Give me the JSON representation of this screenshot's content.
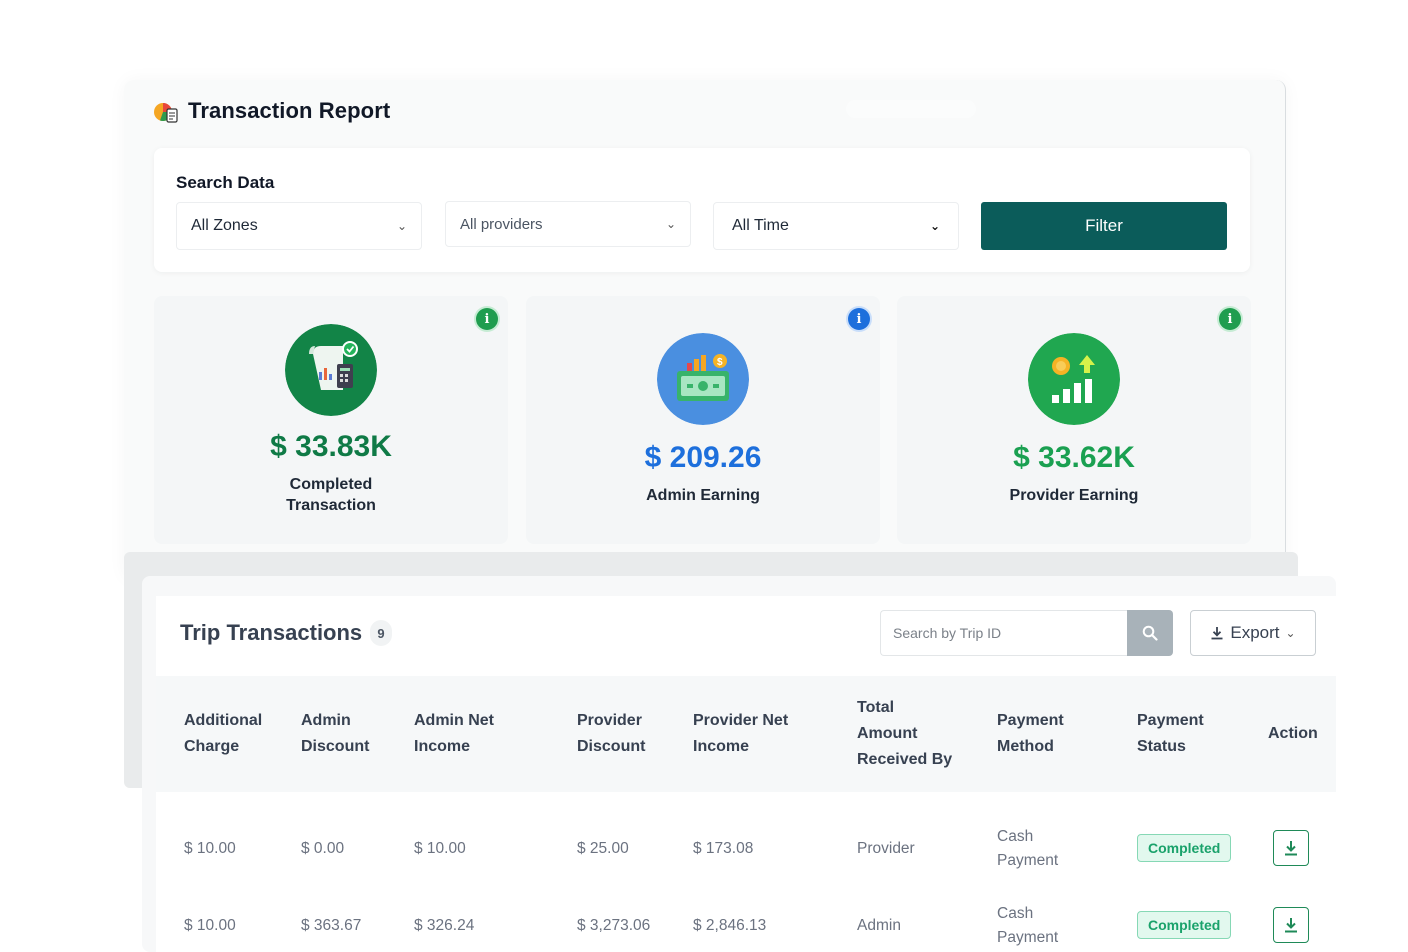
{
  "report": {
    "title": "Transaction Report",
    "search_label": "Search Data",
    "filters": [
      {
        "name": "zone",
        "value": "All Zones"
      },
      {
        "name": "provider",
        "value": "All providers"
      },
      {
        "name": "time",
        "value": "All Time"
      }
    ],
    "filter_button": "Filter"
  },
  "stats": [
    {
      "value": "$ 33.83K",
      "label_line1": "Completed",
      "label_line2": "Transaction",
      "color": "#0f7a46",
      "icon": "receipt-chart-icon"
    },
    {
      "value": "$ 209.26",
      "label_line1": "Admin Earning",
      "label_line2": "",
      "color": "#1d6fdc",
      "icon": "money-wallet-icon"
    },
    {
      "value": "$ 33.62K",
      "label_line1": "Provider Earning",
      "label_line2": "",
      "color": "#1aa051",
      "icon": "growth-coin-icon"
    }
  ],
  "transactions": {
    "title": "Trip Transactions",
    "count": "9",
    "search_placeholder": "Search by Trip ID",
    "export_label": "Export",
    "columns": [
      [
        "Additional",
        "Charge"
      ],
      [
        "Admin",
        "Discount"
      ],
      [
        "Admin Net",
        "Income"
      ],
      [
        "Provider",
        "Discount"
      ],
      [
        "Provider Net",
        "Income"
      ],
      [
        "Total",
        "Amount",
        "Received By"
      ],
      [
        "Payment",
        "Method"
      ],
      [
        "Payment",
        "Status"
      ],
      [
        "Action"
      ]
    ],
    "rows": [
      {
        "additional_charge": "$ 10.00",
        "admin_discount": "$ 0.00",
        "admin_net_income": "$ 10.00",
        "provider_discount": "$ 25.00",
        "provider_net_income": "$ 173.08",
        "received_by": "Provider",
        "method_line1": "Cash",
        "method_line2": "Payment",
        "status": "Completed"
      },
      {
        "additional_charge": "$ 10.00",
        "admin_discount": "$ 363.67",
        "admin_net_income": "$ 326.24",
        "provider_discount": "$ 3,273.06",
        "provider_net_income": "$ 2,846.13",
        "received_by": "Admin",
        "method_line1": "Cash",
        "method_line2": "Payment",
        "status": "Completed"
      }
    ]
  },
  "colors": {
    "primary": "#0b5c5a",
    "success": "#1aa26b",
    "admin_blue": "#1d6fdc"
  }
}
